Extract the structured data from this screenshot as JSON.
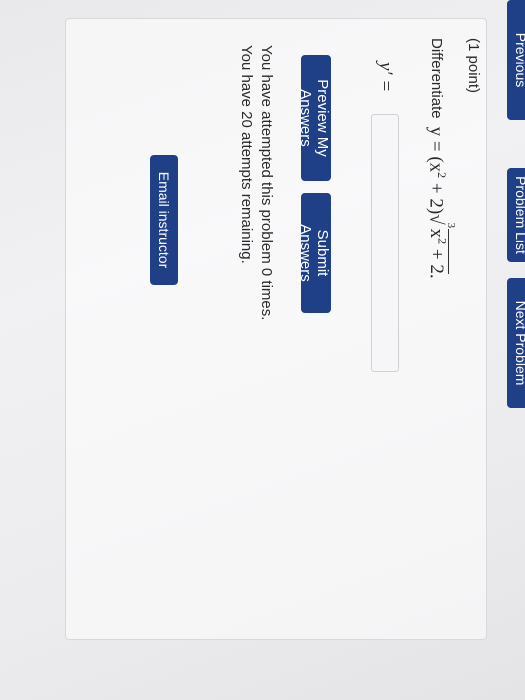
{
  "nav": {
    "previous_label": "Previous",
    "list_label": "Problem List",
    "next_label": "Next Problem"
  },
  "problem": {
    "points": "(1 point)",
    "prompt": "Differentiate",
    "math_lhs": "y = (x",
    "math_exp1": "2",
    "math_mid": " + 2)",
    "root_index": "3",
    "root_base": "x",
    "root_exp": "2",
    "root_rest": " + 2",
    "math_end": "."
  },
  "answer": {
    "label": "y′ =",
    "value": ""
  },
  "buttons": {
    "preview": "Preview My Answers",
    "submit": "Submit Answers",
    "email": "Email instructor"
  },
  "status": {
    "attempts_made": "You have attempted this problem 0 times.",
    "attempts_left": "You have 20 attempts remaining."
  }
}
